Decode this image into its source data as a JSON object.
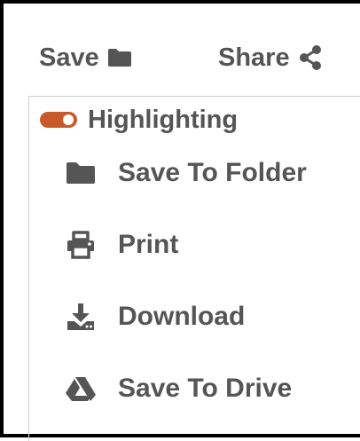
{
  "toolbar": {
    "save_label": "Save",
    "share_label": "Share"
  },
  "menu": {
    "highlighting": {
      "label": "Highlighting",
      "enabled": true
    },
    "items": [
      {
        "label": "Save To Folder",
        "icon": "folder-icon"
      },
      {
        "label": "Print",
        "icon": "printer-icon"
      },
      {
        "label": "Download",
        "icon": "download-icon"
      },
      {
        "label": "Save To Drive",
        "icon": "drive-icon"
      }
    ]
  },
  "colors": {
    "text": "#555555",
    "toggle_on": "#c8592a",
    "border": "#000000"
  }
}
